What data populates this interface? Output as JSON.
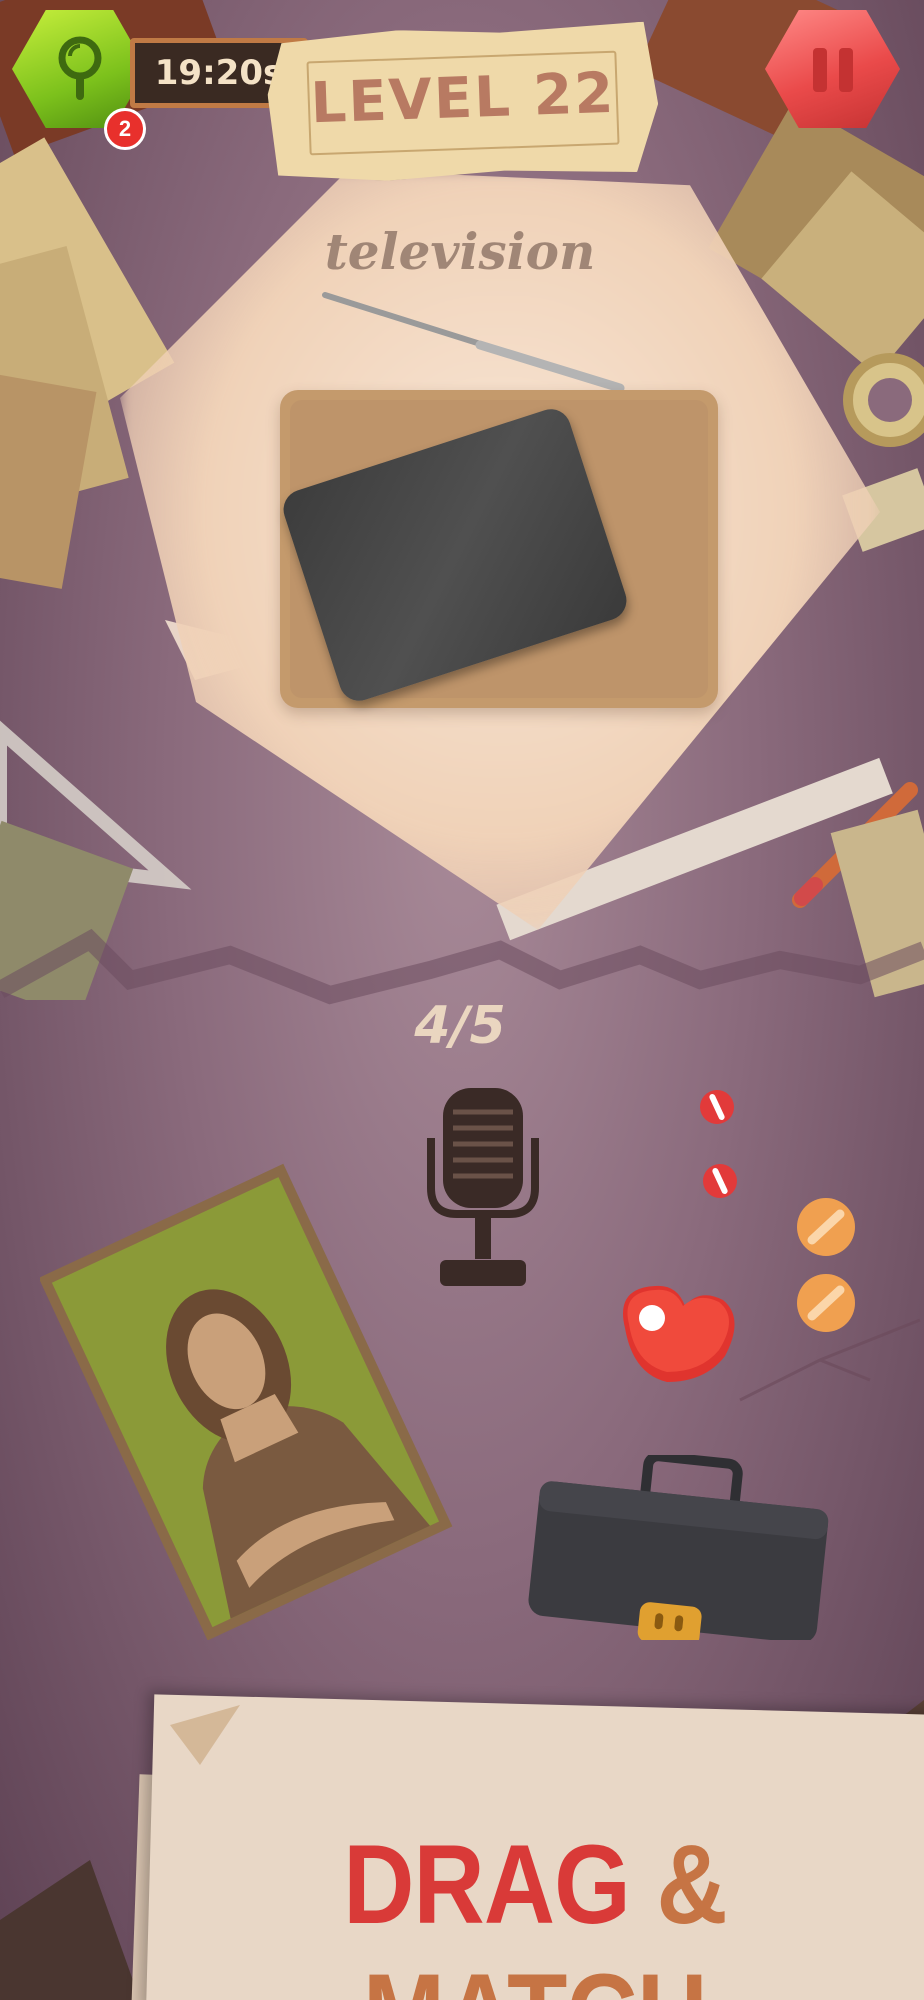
{
  "hud": {
    "hint_count": "2",
    "timer": "19:20s",
    "level_label": "LEVEL 22"
  },
  "target": {
    "word": "television",
    "object": "television-silhouette"
  },
  "progress": {
    "text": "4/5",
    "found": 4,
    "total": 5
  },
  "items": [
    "microphone",
    "mona-lisa-painting",
    "red-heart-pill",
    "red-pills",
    "orange-pills",
    "briefcase"
  ],
  "banner": {
    "word1": "DRAG",
    "word2": "& MATCH"
  },
  "colors": {
    "hint_green": "#8fd224",
    "pause_red": "#ea4a4a",
    "banner_red": "#d93a38",
    "banner_orange": "#c67444"
  }
}
